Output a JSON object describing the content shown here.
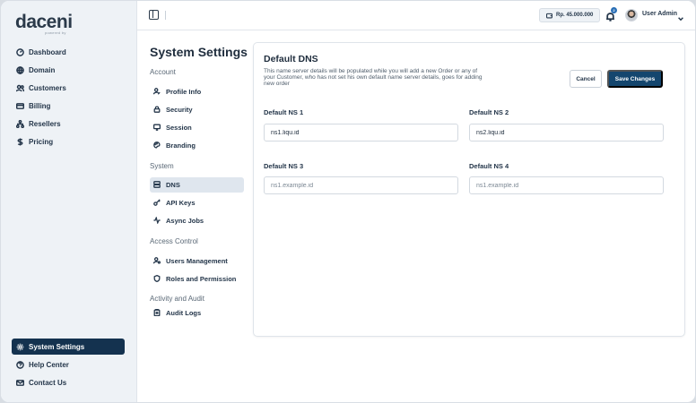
{
  "brand": {
    "logo": "daceni",
    "tagline": "powered by"
  },
  "sidebar": {
    "items": [
      {
        "label": "Dashboard",
        "icon": "dashboard-icon"
      },
      {
        "label": "Domain",
        "icon": "globe-icon"
      },
      {
        "label": "Customers",
        "icon": "users-icon"
      },
      {
        "label": "Billing",
        "icon": "credit-card-icon"
      },
      {
        "label": "Resellers",
        "icon": "network-icon"
      },
      {
        "label": "Pricing",
        "icon": "dollar-icon"
      }
    ],
    "bottom_items": [
      {
        "label": "System Settings",
        "icon": "gear-icon",
        "active": true
      },
      {
        "label": "Help Center",
        "icon": "help-icon"
      },
      {
        "label": "Contact Us",
        "icon": "mail-icon"
      }
    ]
  },
  "topbar": {
    "balance": "Rp. 45.000.000",
    "notification_count": "2",
    "user_name": "User Admin"
  },
  "settings_nav": {
    "title": "System Settings",
    "groups": [
      {
        "label": "Account",
        "items": [
          "Profile Info",
          "Security",
          "Session",
          "Branding"
        ]
      },
      {
        "label": "System",
        "items": [
          "DNS",
          "API Keys",
          "Async Jobs"
        ]
      },
      {
        "label": "Access Control",
        "items": [
          "Users Management",
          "Roles and Permission"
        ]
      },
      {
        "label": "Activity and Audit",
        "items": [
          "Audit Logs"
        ]
      }
    ],
    "active_item": "DNS"
  },
  "dns": {
    "title": "Default DNS",
    "description": "This name server details will be populated while you will add a new Order or any of your Customer, who has not set his own default name server details, goes for adding new order",
    "cancel_label": "Cancel",
    "save_label": "Save Changes",
    "fields": [
      {
        "label": "Default NS 1",
        "value": "ns1.liqu.id",
        "placeholder": ""
      },
      {
        "label": "Default NS 2",
        "value": "ns2.liqu.id",
        "placeholder": ""
      },
      {
        "label": "Default NS 3",
        "value": "",
        "placeholder": "ns1.example.id"
      },
      {
        "label": "Default NS 4",
        "value": "",
        "placeholder": "ns1.example.id"
      }
    ]
  },
  "colors": {
    "accent": "#14466e",
    "sidebar_active": "#14324f",
    "sidebar_bg": "#eef2f6"
  }
}
